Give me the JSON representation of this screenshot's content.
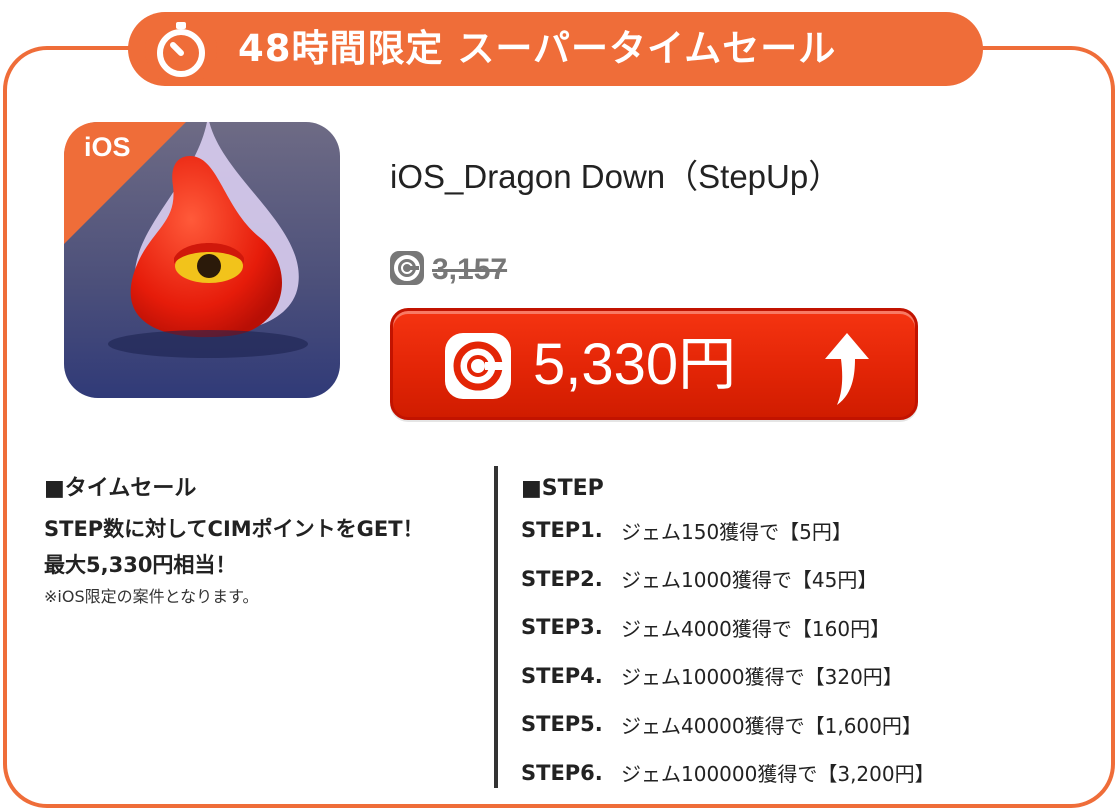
{
  "banner": {
    "title": "48時間限定 スーパータイムセール",
    "icon": "stopwatch-icon"
  },
  "app": {
    "platform_badge": "iOS",
    "title": "iOS_Dragon Down（StepUp）"
  },
  "price": {
    "original": "3,157",
    "current": "5,330円",
    "coin_icon": "coin-icon",
    "arrow_icon": "up-arrow-icon"
  },
  "timesale": {
    "heading": "■タイムセール",
    "line1": "STEP数に対してCIMポイントをGET！",
    "line2": "最大5,330円相当！",
    "note": "※iOS限定の案件となります。"
  },
  "steps": {
    "heading": "■STEP",
    "items": [
      {
        "label": "STEP1.",
        "text": "ジェム150獲得で【5円】"
      },
      {
        "label": "STEP2.",
        "text": "ジェム1000獲得で【45円】"
      },
      {
        "label": "STEP3.",
        "text": "ジェム4000獲得で【160円】"
      },
      {
        "label": "STEP4.",
        "text": "ジェム10000獲得で【320円】"
      },
      {
        "label": "STEP5.",
        "text": "ジェム40000獲得で【1,600円】"
      },
      {
        "label": "STEP6.",
        "text": "ジェム100000獲得で【3,200円】"
      }
    ]
  },
  "colors": {
    "accent": "#ef6d39",
    "button": "#e32506"
  }
}
